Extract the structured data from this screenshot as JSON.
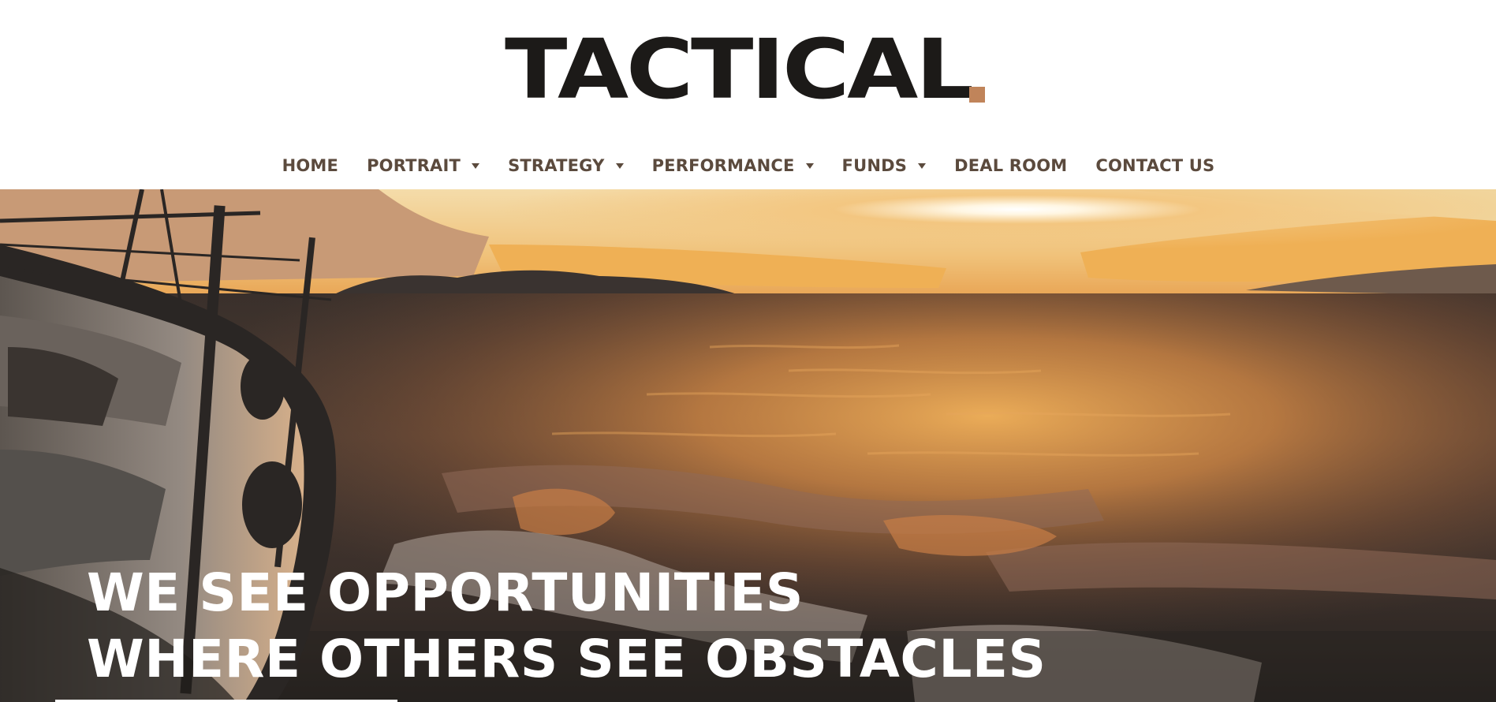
{
  "brand": {
    "name": "TACTICAL",
    "dot_color": "#c0845a",
    "text_color": "#1c1a18"
  },
  "nav": {
    "text_color": "#5b4a3d",
    "items": [
      {
        "label": "HOME",
        "has_dropdown": false
      },
      {
        "label": "PORTRAIT",
        "has_dropdown": true
      },
      {
        "label": "STRATEGY",
        "has_dropdown": true
      },
      {
        "label": "PERFORMANCE",
        "has_dropdown": true
      },
      {
        "label": "FUNDS",
        "has_dropdown": true
      },
      {
        "label": "DEAL ROOM",
        "has_dropdown": false
      },
      {
        "label": "CONTACT US",
        "has_dropdown": false
      }
    ],
    "dropdown_icon": "caret-down-icon"
  },
  "hero": {
    "headline_line_1": "WE SEE OPPORTUNITIES",
    "headline_line_2": "WHERE OTHERS SEE OBSTACLES",
    "headline_color": "#ffffff",
    "underline_color": "#ffffff",
    "image_subject": "sunset-sea-sailboat-image",
    "palette": {
      "sky_light": "#f1d59c",
      "sky_glow": "#efb055",
      "sun": "#ffffff",
      "sea_dark": "#2c2724",
      "sea_mid": "#6a4a3a",
      "sea_amber": "#c77e46",
      "boat_hull": "#8c8178",
      "boat_dark": "#2a2624"
    }
  }
}
